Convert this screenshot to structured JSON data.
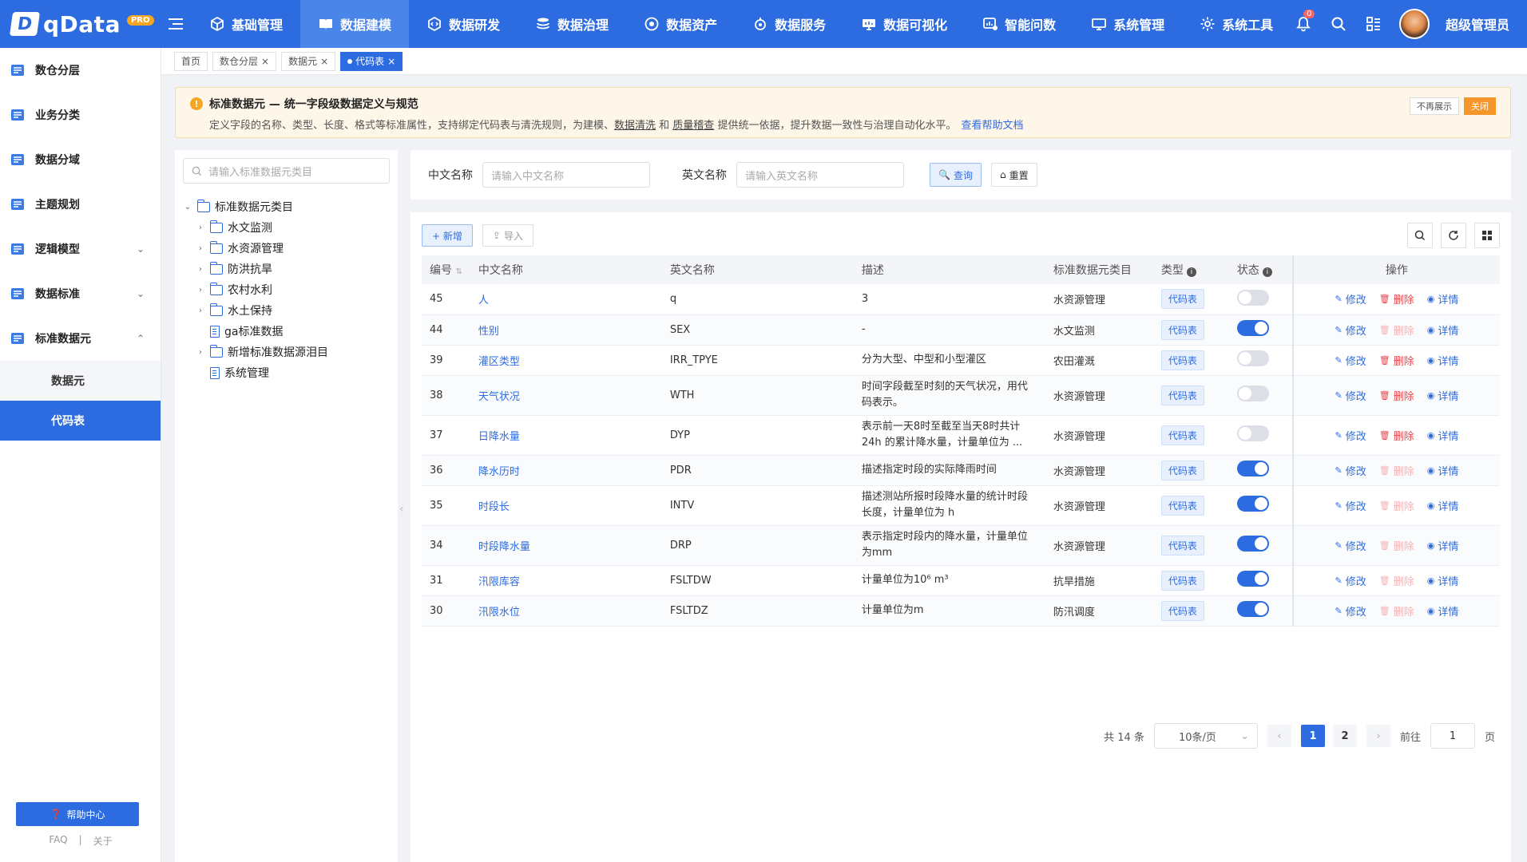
{
  "app": {
    "logo_text": "qData",
    "logo_badge": "PRO"
  },
  "nav": [
    {
      "label": "基础管理",
      "icon": "cube-icon",
      "active": false
    },
    {
      "label": "数据建模",
      "icon": "book-icon",
      "active": true
    },
    {
      "label": "数据研发",
      "icon": "cube-code-icon",
      "active": false
    },
    {
      "label": "数据治理",
      "icon": "stack-icon",
      "active": false
    },
    {
      "label": "数据资产",
      "icon": "target-icon",
      "active": false
    },
    {
      "label": "数据服务",
      "icon": "service-icon",
      "active": false
    },
    {
      "label": "数据可视化",
      "icon": "screen-icon",
      "active": false
    },
    {
      "label": "智能问数",
      "icon": "chart-chat-icon",
      "active": false
    },
    {
      "label": "系统管理",
      "icon": "monitor-icon",
      "active": false
    },
    {
      "label": "系统工具",
      "icon": "gear-icon",
      "active": false
    }
  ],
  "user": {
    "name": "超级管理员",
    "bell_count": "0"
  },
  "sidebar": {
    "items": [
      {
        "label": "数仓分层",
        "icon": "layers-icon"
      },
      {
        "label": "业务分类",
        "icon": "stack-icon"
      },
      {
        "label": "数据分域",
        "icon": "domain-icon"
      },
      {
        "label": "主题规划",
        "icon": "topic-icon"
      },
      {
        "label": "逻辑模型",
        "icon": "model-icon",
        "arrow": "⌄"
      },
      {
        "label": "数据标准",
        "icon": "standard-icon",
        "arrow": "⌄"
      },
      {
        "label": "标准数据元",
        "icon": "element-icon",
        "arrow": "⌃"
      }
    ],
    "subitems": [
      {
        "label": "数据元",
        "active": false
      },
      {
        "label": "代码表",
        "active": true
      }
    ],
    "help_label": "帮助中心",
    "footer_faq": "FAQ",
    "footer_sep": "|",
    "footer_about": "关于"
  },
  "tabs": [
    {
      "label": "首页",
      "closable": false,
      "active": false
    },
    {
      "label": "数仓分层",
      "closable": true,
      "active": false
    },
    {
      "label": "数据元",
      "closable": true,
      "active": false
    },
    {
      "label": "代码表",
      "closable": true,
      "active": true
    }
  ],
  "alert": {
    "title": "标准数据元 — 统一字段级数据定义与规范",
    "desc_prefix": "定义字段的名称、类型、长度、格式等标准属性，支持绑定代码表与清洗规则，为建模、",
    "desc_link1": "数据清洗",
    "desc_mid": " 和 ",
    "desc_link2": "质量稽查",
    "desc_suffix": " 提供统一依据，提升数据一致性与治理自动化水平。",
    "help_link": "查看帮助文档",
    "hide_label": "不再展示",
    "close_label": "关闭"
  },
  "tree": {
    "search_placeholder": "请输入标准数据元类目",
    "root": "标准数据元类目",
    "children": [
      {
        "label": "水文监测",
        "type": "folder"
      },
      {
        "label": "水资源管理",
        "type": "folder"
      },
      {
        "label": "防洪抗旱",
        "type": "folder"
      },
      {
        "label": "农村水利",
        "type": "folder"
      },
      {
        "label": "水土保持",
        "type": "folder"
      },
      {
        "label": "ga标准数据",
        "type": "doc"
      },
      {
        "label": "新增标准数据源泪目",
        "type": "folder"
      },
      {
        "label": "系统管理",
        "type": "doc"
      }
    ]
  },
  "query": {
    "cn_label": "中文名称",
    "cn_placeholder": "请输入中文名称",
    "en_label": "英文名称",
    "en_placeholder": "请输入英文名称",
    "search_label": "查询",
    "reset_label": "重置"
  },
  "toolbar": {
    "add_label": "+ 新增",
    "import_label": "导入"
  },
  "table": {
    "headers": {
      "id": "编号",
      "cn": "中文名称",
      "en": "英文名称",
      "desc": "描述",
      "category": "标准数据元类目",
      "type": "类型",
      "status": "状态",
      "ops": "操作"
    },
    "rows": [
      {
        "id": "45",
        "cn": "人",
        "en": "q",
        "desc": "3",
        "category": "水资源管理",
        "type": "代码表",
        "status": false,
        "del_enabled": true
      },
      {
        "id": "44",
        "cn": "性别",
        "en": "SEX",
        "desc": "-",
        "category": "水文监测",
        "type": "代码表",
        "status": true,
        "del_enabled": false
      },
      {
        "id": "39",
        "cn": "灌区类型",
        "en": "IRR_TPYE",
        "desc": "分为大型、中型和小型灌区",
        "category": "农田灌溉",
        "type": "代码表",
        "status": false,
        "del_enabled": true
      },
      {
        "id": "38",
        "cn": "天气状况",
        "en": "WTH",
        "desc": "时间字段截至时刻的天气状况，用代码表示。",
        "category": "水资源管理",
        "type": "代码表",
        "status": false,
        "del_enabled": true
      },
      {
        "id": "37",
        "cn": "日降水量",
        "en": "DYP",
        "desc": "表示前一天8时至截至当天8时共计24h 的累计降水量，计量单位为 ...",
        "category": "水资源管理",
        "type": "代码表",
        "status": false,
        "del_enabled": true
      },
      {
        "id": "36",
        "cn": "降水历时",
        "en": "PDR",
        "desc": "描述指定时段的实际降雨时间",
        "category": "水资源管理",
        "type": "代码表",
        "status": true,
        "del_enabled": false
      },
      {
        "id": "35",
        "cn": "时段长",
        "en": "INTV",
        "desc": "描述测站所报时段降水量的统计时段长度，计量单位为 h",
        "category": "水资源管理",
        "type": "代码表",
        "status": true,
        "del_enabled": false
      },
      {
        "id": "34",
        "cn": "时段降水量",
        "en": "DRP",
        "desc": "表示指定时段内的降水量，计量单位为mm",
        "category": "水资源管理",
        "type": "代码表",
        "status": true,
        "del_enabled": false
      },
      {
        "id": "31",
        "cn": "汛限库容",
        "en": "FSLTDW",
        "desc": "计量单位为10⁶ m³",
        "category": "抗旱措施",
        "type": "代码表",
        "status": true,
        "del_enabled": false
      },
      {
        "id": "30",
        "cn": "汛限水位",
        "en": "FSLTDZ",
        "desc": "计量单位为m",
        "category": "防汛调度",
        "type": "代码表",
        "status": true,
        "del_enabled": false
      }
    ],
    "op_edit": "修改",
    "op_delete": "删除",
    "op_detail": "详情"
  },
  "pager": {
    "total": "共 14 条",
    "page_size": "10条/页",
    "pages": [
      "1",
      "2"
    ],
    "current": "1",
    "goto_prefix": "前往",
    "goto_value": "1",
    "goto_suffix": "页",
    "prev": "‹",
    "next": "›"
  }
}
